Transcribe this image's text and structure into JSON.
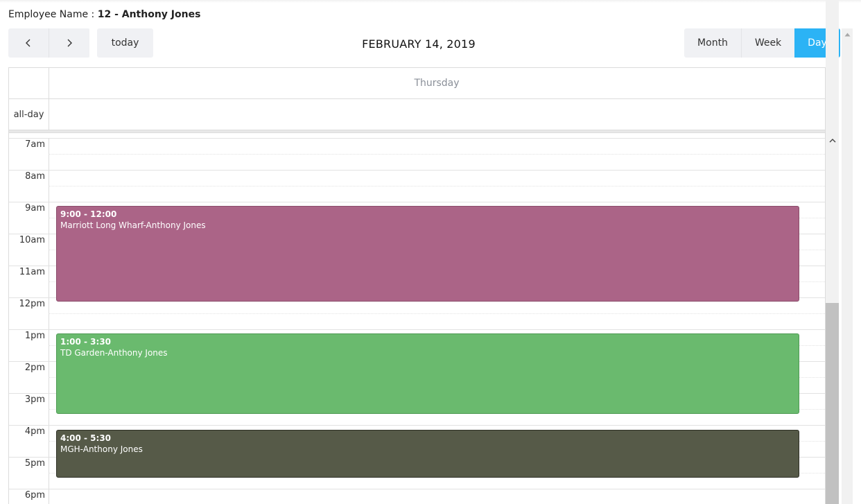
{
  "header": {
    "employee_label": "Employee Name : ",
    "employee_value": "12 - Anthony Jones"
  },
  "toolbar": {
    "prev_icon": "chevron-left-icon",
    "next_icon": "chevron-right-icon",
    "today_label": "today",
    "title": "FEBRUARY 14, 2019",
    "views": [
      {
        "label": "Month",
        "active": false
      },
      {
        "label": "Week",
        "active": false
      },
      {
        "label": "Day",
        "active": true
      }
    ],
    "accent_color": "#2bb3f5"
  },
  "calendar": {
    "day_header": "Thursday",
    "allday_label": "all-day",
    "time_labels": [
      "7am",
      "8am",
      "9am",
      "10am",
      "11am",
      "12pm",
      "1pm",
      "2pm",
      "3pm",
      "4pm",
      "5pm",
      "6pm"
    ],
    "events": [
      {
        "time": "9:00 - 12:00",
        "title": "Marriott Long Wharf-Anthony Jones",
        "color": "#ab6487"
      },
      {
        "time": "1:00 - 3:30",
        "title": "TD Garden-Anthony Jones",
        "color": "#6aba6e"
      },
      {
        "time": "4:00 - 5:30",
        "title": "MGH-Anthony Jones",
        "color": "#565a48"
      }
    ]
  }
}
